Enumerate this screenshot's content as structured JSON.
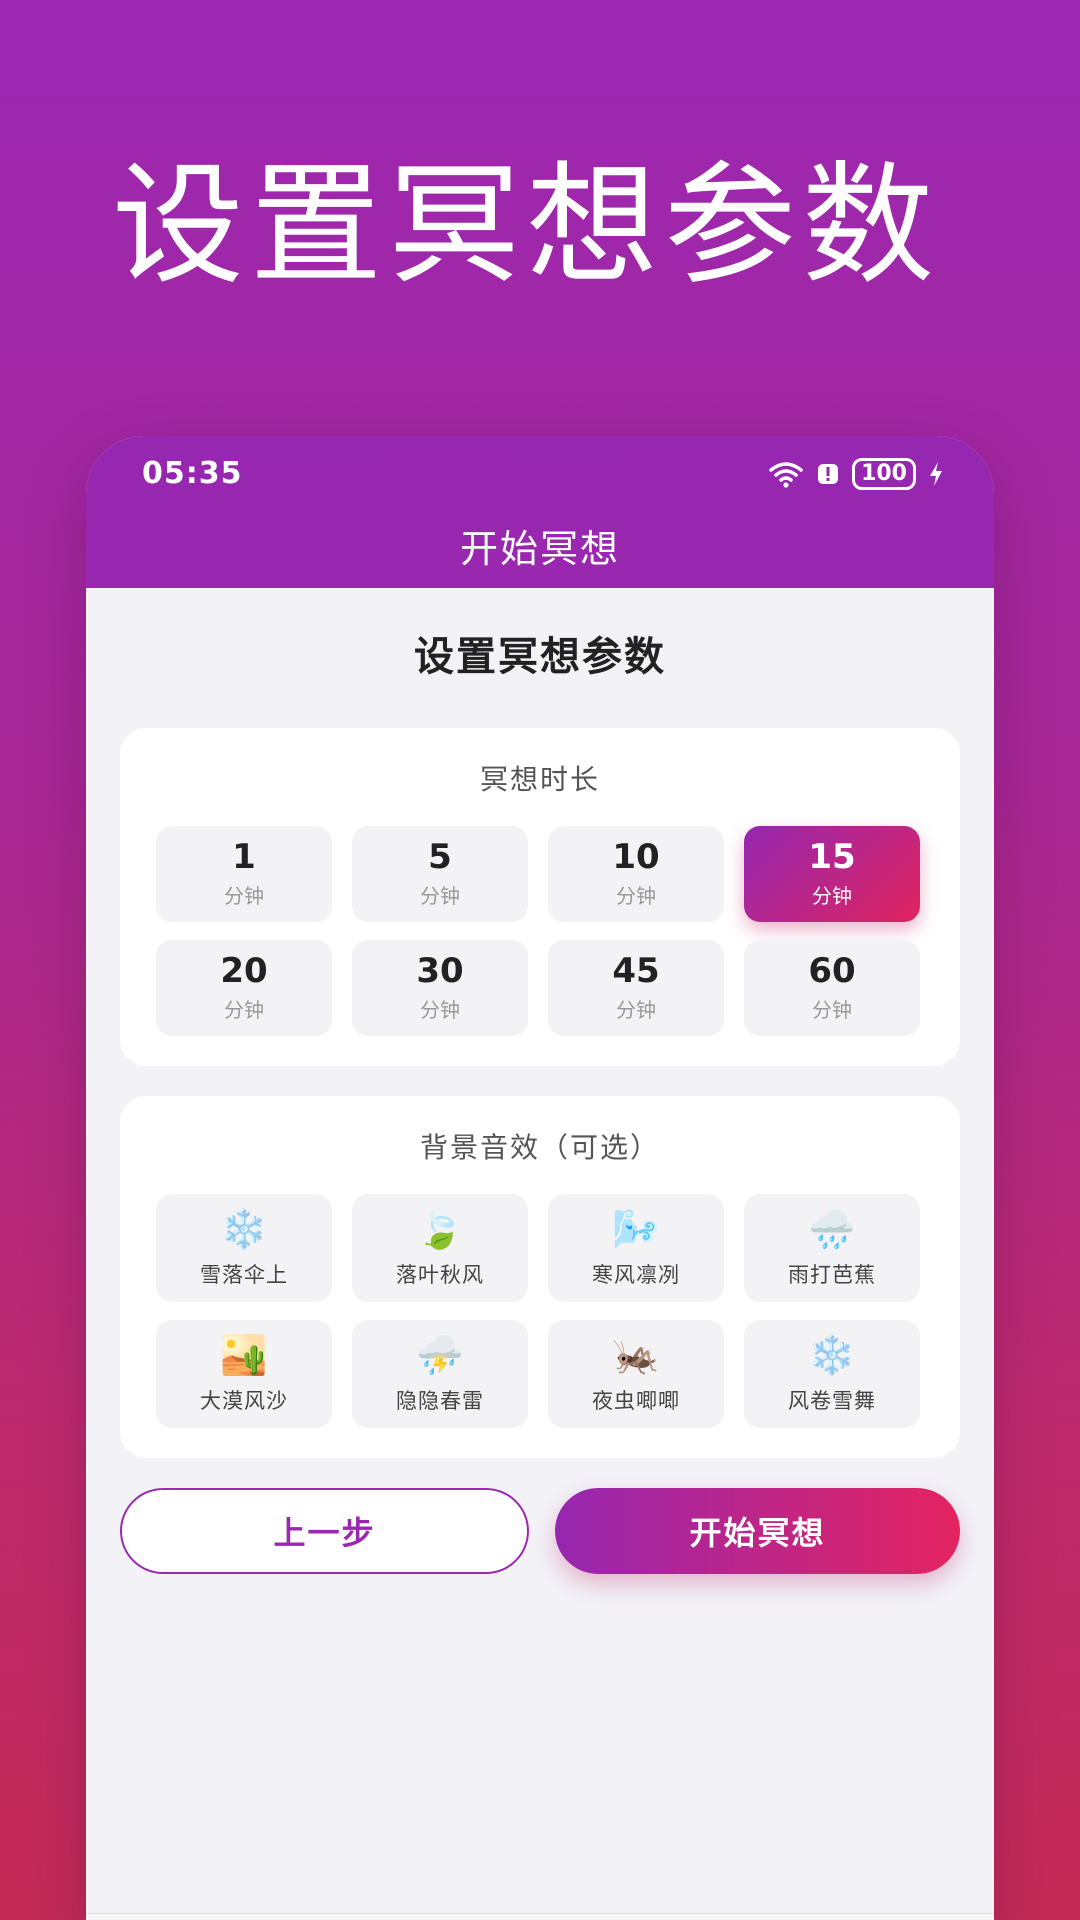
{
  "promo": {
    "title": "设置冥想参数"
  },
  "status_bar": {
    "time": "05:35",
    "battery": "100"
  },
  "header": {
    "title": "开始冥想"
  },
  "page": {
    "heading": "设置冥想参数"
  },
  "duration": {
    "title": "冥想时长",
    "unit": "分钟",
    "selected": "15",
    "options": [
      {
        "value": "1",
        "unit": "分钟"
      },
      {
        "value": "5",
        "unit": "分钟"
      },
      {
        "value": "10",
        "unit": "分钟"
      },
      {
        "value": "15",
        "unit": "分钟"
      },
      {
        "value": "20",
        "unit": "分钟"
      },
      {
        "value": "30",
        "unit": "分钟"
      },
      {
        "value": "45",
        "unit": "分钟"
      },
      {
        "value": "60",
        "unit": "分钟"
      }
    ]
  },
  "sounds": {
    "title": "背景音效（可选）",
    "items": [
      {
        "label": "雪落伞上",
        "icon": "snowflake-icon",
        "glyph": "❄️"
      },
      {
        "label": "落叶秋风",
        "icon": "leaf-icon",
        "glyph": "🍃"
      },
      {
        "label": "寒风凛冽",
        "icon": "wind-face-icon",
        "glyph": "🌬️"
      },
      {
        "label": "雨打芭蕉",
        "icon": "rain-cloud-icon",
        "glyph": "🌧️"
      },
      {
        "label": "大漠风沙",
        "icon": "desert-icon",
        "glyph": "🏜️"
      },
      {
        "label": "隐隐春雷",
        "icon": "thunder-cloud-icon",
        "glyph": "⛈️"
      },
      {
        "label": "夜虫唧唧",
        "icon": "cricket-icon",
        "glyph": "🦗"
      },
      {
        "label": "风卷雪舞",
        "icon": "snowflakes-icon",
        "glyph": "❄️"
      }
    ]
  },
  "actions": {
    "prev_label": "上一步",
    "start_label": "开始冥想"
  },
  "colors": {
    "accent_start": "#9627B0",
    "accent_end": "#E42460"
  }
}
